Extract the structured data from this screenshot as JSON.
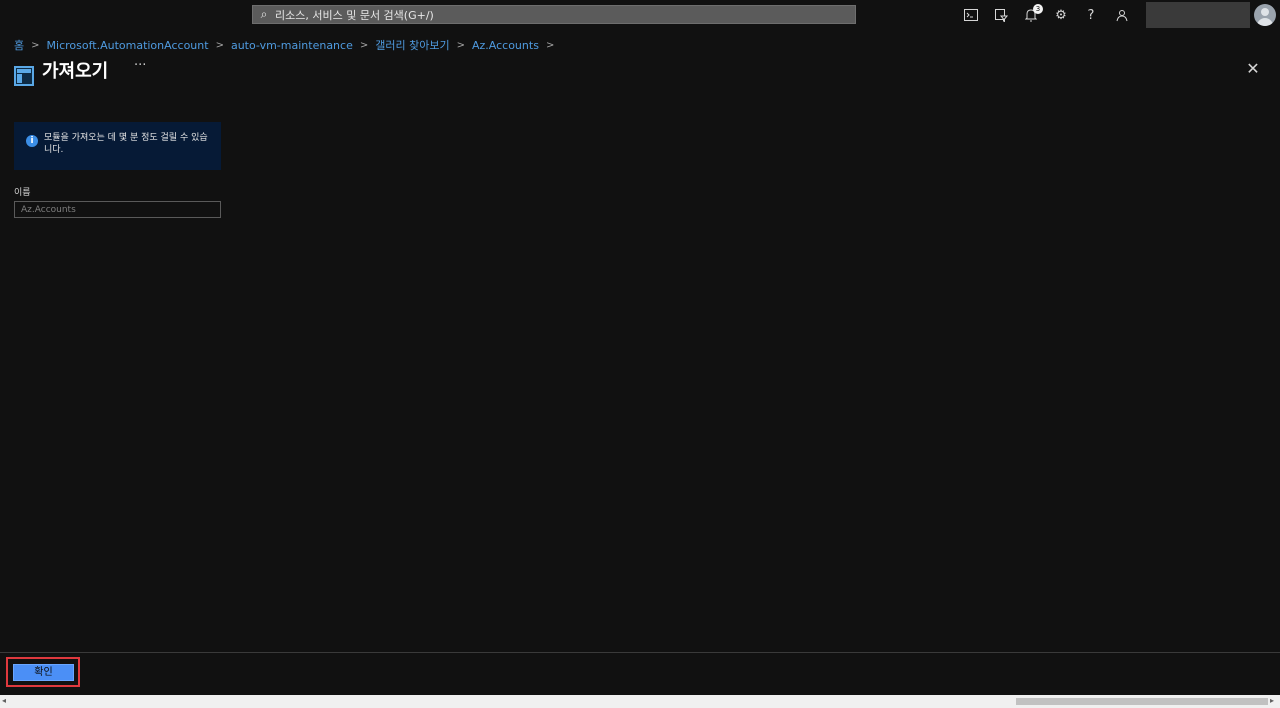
{
  "topbar": {
    "search_placeholder": "리소스, 서비스 및 문서 검색(G+/)",
    "notification_count": "3",
    "icons": [
      "cloud-shell-icon",
      "directory-filter-icon",
      "notification-bell-icon",
      "settings-gear-icon",
      "help-icon",
      "feedback-icon"
    ]
  },
  "breadcrumb": [
    "홈",
    "Microsoft.AutomationAccount",
    "auto-vm-maintenance",
    "갤러리 찾아보기",
    "Az.Accounts"
  ],
  "page": {
    "title": "가져오기",
    "more": "···",
    "close": "✕"
  },
  "info": {
    "text": "모듈을 가져오는 데 몇 분 정도 걸릴 수 있습니다."
  },
  "form": {
    "name_label": "이름",
    "name_placeholder": "Az.Accounts"
  },
  "footer": {
    "ok_label": "확인"
  },
  "colors": {
    "background": "#111111",
    "link": "#4f9be0",
    "primary_button": "#4b8ff6",
    "highlight": "#e0393e",
    "info_bg": "#061a36"
  }
}
